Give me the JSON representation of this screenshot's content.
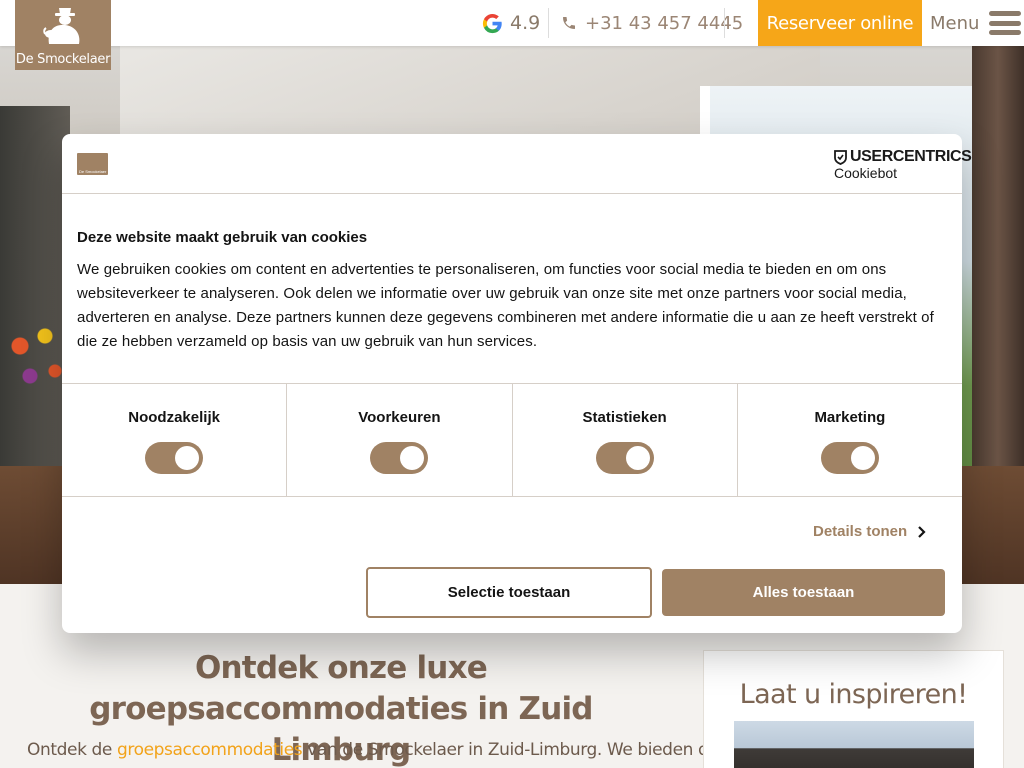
{
  "header": {
    "logo_label": "De Smockelaer",
    "rating": "4.9",
    "phone": "+31 43 457 4445",
    "reserve_label": "Reserveer online",
    "menu_label": "Menu",
    "icons": [
      "google-icon",
      "phone-icon",
      "hamburger-icon"
    ],
    "accent_color": "#f6a618"
  },
  "content": {
    "title": "Ontdek onze luxe groepsaccommodaties in Zuid Limburg",
    "intro_prefix": "Ontdek de ",
    "intro_link": "groepsaccommodaties",
    "intro_suffix": " van de Smockelaer in Zuid-Limburg. We bieden de",
    "inspire_title": "Laat u inspireren!"
  },
  "cookie": {
    "brand_top": "USERCENTRICS",
    "brand_sub": "Cookiebot",
    "heading": "Deze website maakt gebruik van cookies",
    "body": "We gebruiken cookies om content en advertenties te personaliseren, om functies voor social media te bieden en om ons websiteverkeer te analyseren. Ook delen we informatie over uw gebruik van onze site met onze partners voor social media, adverteren en analyse. Deze partners kunnen deze gegevens combineren met andere informatie die u aan ze heeft verstrekt of die ze hebben verzameld op basis van uw gebruik van hun services.",
    "categories": [
      {
        "label": "Noodzakelijk",
        "enabled": true
      },
      {
        "label": "Voorkeuren",
        "enabled": true
      },
      {
        "label": "Statistieken",
        "enabled": true
      },
      {
        "label": "Marketing",
        "enabled": true
      }
    ],
    "details_label": "Details tonen",
    "select_label": "Selectie toestaan",
    "allow_all_label": "Alles toestaan",
    "accent_color": "#a08264"
  }
}
